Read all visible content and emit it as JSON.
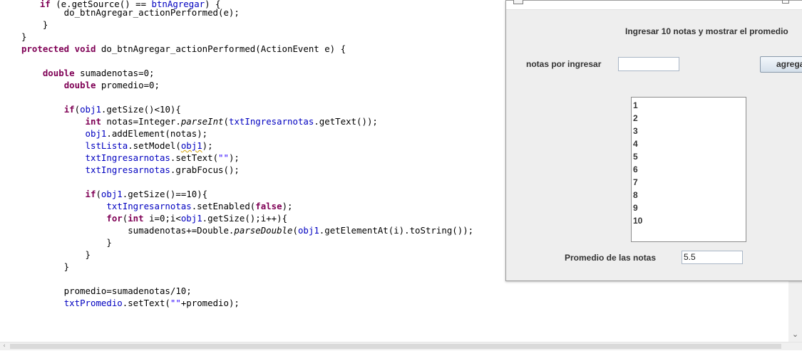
{
  "editor": {
    "lines": [
      [
        {
          "t": "    "
        },
        {
          "t": "if",
          "c": "kw"
        },
        {
          "t": " (e.getSource() == "
        },
        {
          "t": "btnAgregar",
          "c": "field"
        },
        {
          "t": ") {"
        }
      ],
      [
        {
          "t": "        do_btnAgregar_actionPerformed(e);"
        }
      ],
      [
        {
          "t": "    }"
        }
      ],
      [
        {
          "t": "}"
        }
      ],
      [
        {
          "t": "protected",
          "c": "kw"
        },
        {
          "t": " "
        },
        {
          "t": "void",
          "c": "kw"
        },
        {
          "t": " do_btnAgregar_actionPerformed(ActionEvent e) {"
        }
      ],
      [
        {
          "t": ""
        }
      ],
      [
        {
          "t": "    "
        },
        {
          "t": "double",
          "c": "kw"
        },
        {
          "t": " sumadenotas=0;"
        }
      ],
      [
        {
          "t": "        "
        },
        {
          "t": "double",
          "c": "kw"
        },
        {
          "t": " promedio=0;"
        }
      ],
      [
        {
          "t": ""
        }
      ],
      [
        {
          "t": "        "
        },
        {
          "t": "if",
          "c": "kw"
        },
        {
          "t": "("
        },
        {
          "t": "obj1",
          "c": "field"
        },
        {
          "t": ".getSize()<10){"
        }
      ],
      [
        {
          "t": "            "
        },
        {
          "t": "int",
          "c": "kw"
        },
        {
          "t": " notas=Integer."
        },
        {
          "t": "parseInt",
          "c": "it"
        },
        {
          "t": "("
        },
        {
          "t": "txtIngresarnotas",
          "c": "field"
        },
        {
          "t": ".getText());"
        }
      ],
      [
        {
          "t": "            "
        },
        {
          "t": "obj1",
          "c": "field"
        },
        {
          "t": ".addElement(notas);"
        }
      ],
      [
        {
          "t": "            "
        },
        {
          "t": "lstLista",
          "c": "field"
        },
        {
          "t": ".setModel("
        },
        {
          "t": "obj1",
          "c": "field sq"
        },
        {
          "t": ");"
        }
      ],
      [
        {
          "t": "            "
        },
        {
          "t": "txtIngresarnotas",
          "c": "field"
        },
        {
          "t": ".setText("
        },
        {
          "t": "\"\"",
          "c": "str"
        },
        {
          "t": ");"
        }
      ],
      [
        {
          "t": "            "
        },
        {
          "t": "txtIngresarnotas",
          "c": "field"
        },
        {
          "t": ".grabFocus();"
        }
      ],
      [
        {
          "t": ""
        }
      ],
      [
        {
          "t": "            "
        },
        {
          "t": "if",
          "c": "kw"
        },
        {
          "t": "("
        },
        {
          "t": "obj1",
          "c": "field"
        },
        {
          "t": ".getSize()==10){"
        }
      ],
      [
        {
          "t": "                "
        },
        {
          "t": "txtIngresarnotas",
          "c": "field"
        },
        {
          "t": ".setEnabled("
        },
        {
          "t": "false",
          "c": "kw"
        },
        {
          "t": ");"
        }
      ],
      [
        {
          "t": "                "
        },
        {
          "t": "for",
          "c": "kw"
        },
        {
          "t": "("
        },
        {
          "t": "int",
          "c": "kw"
        },
        {
          "t": " i=0;i<"
        },
        {
          "t": "obj1",
          "c": "field"
        },
        {
          "t": ".getSize();i++){"
        }
      ],
      [
        {
          "t": "                    sumadenotas+=Double."
        },
        {
          "t": "parseDouble",
          "c": "it"
        },
        {
          "t": "("
        },
        {
          "t": "obj1",
          "c": "field"
        },
        {
          "t": ".getElementAt(i).toString());"
        }
      ],
      [
        {
          "t": "                }"
        }
      ],
      [
        {
          "t": "            }"
        }
      ],
      [
        {
          "t": "        }"
        }
      ],
      [
        {
          "t": ""
        }
      ],
      [
        {
          "t": "        promedio=sumadenotas/10;"
        }
      ],
      [
        {
          "t": "        "
        },
        {
          "t": "txtPromedio",
          "c": "field"
        },
        {
          "t": ".setText("
        },
        {
          "t": "\"\"",
          "c": "str"
        },
        {
          "t": "+promedio);"
        }
      ]
    ]
  },
  "window": {
    "header": "Ingresar 10 notas y mostrar el promedio",
    "notas_label": "notas por ingresar",
    "notas_input_value": "",
    "agregar_label": "agregar",
    "list_items": [
      "1",
      "2",
      "3",
      "4",
      "5",
      "6",
      "7",
      "8",
      "9",
      "10"
    ],
    "promedio_label": "Promedio de las notas",
    "promedio_value": "5.5"
  },
  "scroll": {
    "down_icon": "chevron-down-icon",
    "left_icon": "chevron-left-icon"
  },
  "colors": {
    "keyword": "#7f0055",
    "field": "#0000c0",
    "string": "#2a00ff",
    "window_bg": "#eeeeee"
  }
}
